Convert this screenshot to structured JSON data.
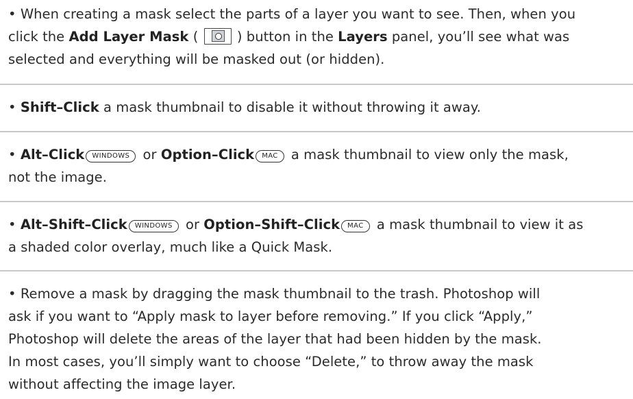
{
  "bullet": "•",
  "tips": [
    {
      "lines": [
        [
          "When creating a mask select the parts of a layer you want to see. Then, when you"
        ],
        [
          "click the ",
          {
            "b": "Add Layer Mask"
          },
          " ( ",
          {
            "icon": "add-layer-mask"
          },
          " ) button in the ",
          {
            "b": "Layers"
          },
          " panel, you’ll see what was"
        ],
        [
          "selected and everything will be masked out (or hidden)."
        ]
      ]
    },
    {
      "lines": [
        [
          {
            "b": "Shift–Click"
          },
          " a mask thumbnail to disable it without throwing it away."
        ]
      ]
    },
    {
      "lines": [
        [
          {
            "b": "Alt–Click"
          },
          {
            "badge": "WINDOWS"
          },
          " or ",
          {
            "b": "Option–Click"
          },
          {
            "badge": "MAC"
          },
          " a mask thumbnail to view only the mask,"
        ],
        [
          "not the image."
        ]
      ]
    },
    {
      "lines": [
        [
          {
            "b": "Alt–Shift–Click"
          },
          {
            "badge": "WINDOWS"
          },
          " or ",
          {
            "b": "Option–Shift–Click"
          },
          {
            "badge": "MAC"
          },
          " a mask thumbnail to view it as"
        ],
        [
          "a shaded color overlay, much like a Quick Mask."
        ]
      ]
    },
    {
      "lines": [
        [
          "Remove a mask by dragging the mask thumbnail to the trash. Photoshop will"
        ],
        [
          "ask if you want to “Apply mask to layer before removing.” If you click “Apply,”"
        ],
        [
          "Photoshop will delete the areas of the layer that had been hidden by the mask."
        ],
        [
          "In most cases, you’ll simply want to choose “Delete,” to throw away the mask"
        ],
        [
          "without affecting the image layer."
        ]
      ]
    }
  ],
  "colors": {
    "text": "#2b2b2b",
    "divider": "#c9c9c9"
  }
}
